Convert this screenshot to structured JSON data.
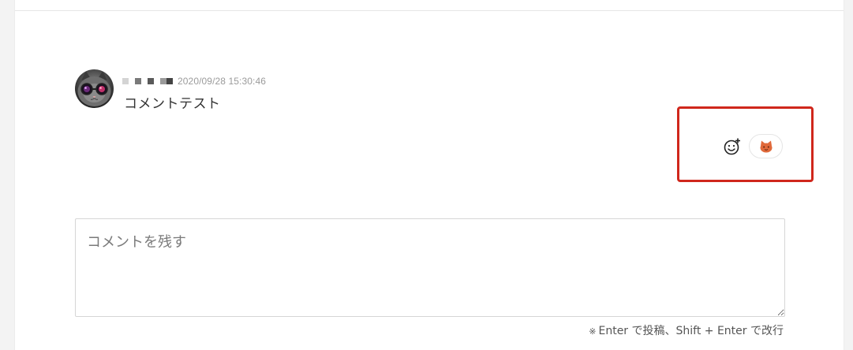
{
  "comment": {
    "author_redacted": true,
    "timestamp": "2020/09/28 15:30:46",
    "text": "コメントテスト"
  },
  "reactions": {
    "add_icon": "add-emoji-icon",
    "items": [
      {
        "emoji_icon": "cat-face-icon",
        "color": "#e0693a"
      }
    ]
  },
  "comment_form": {
    "placeholder": "コメントを残す",
    "value": "",
    "hint_mark": "※",
    "hint": "Enter で投稿、Shift + Enter で改行"
  },
  "colors": {
    "highlight": "#d0271c",
    "background": "#f3f3f3",
    "card": "#ffffff"
  }
}
